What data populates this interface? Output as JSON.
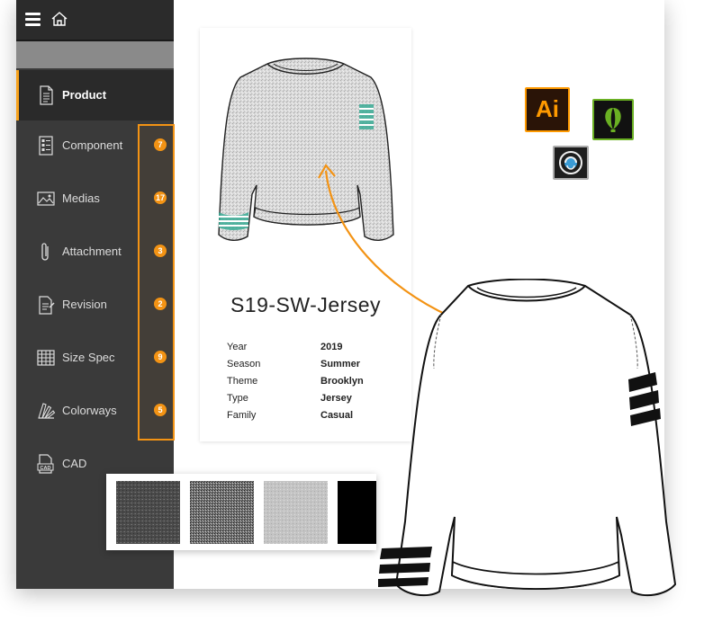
{
  "sidebar": {
    "items": [
      {
        "label": "Product",
        "icon": "document-icon"
      },
      {
        "label": "Component",
        "icon": "component-list-icon",
        "badge": "7"
      },
      {
        "label": "Medias",
        "icon": "image-icon",
        "badge": "17"
      },
      {
        "label": "Attachment",
        "icon": "paperclip-icon",
        "badge": "3"
      },
      {
        "label": "Revision",
        "icon": "revision-document-icon",
        "badge": "2"
      },
      {
        "label": "Size Spec",
        "icon": "grid-table-icon",
        "badge": "9"
      },
      {
        "label": "Colorways",
        "icon": "color-swatch-icon",
        "badge": "5"
      },
      {
        "label": "CAD",
        "icon": "cad-file-icon"
      }
    ]
  },
  "product": {
    "title": "S19-SW-Jersey",
    "attributes": [
      {
        "key": "Year",
        "value": "2019"
      },
      {
        "key": "Season",
        "value": "Summer"
      },
      {
        "key": "Theme",
        "value": "Brooklyn"
      },
      {
        "key": "Type",
        "value": "Jersey"
      },
      {
        "key": "Family",
        "value": "Casual"
      }
    ]
  },
  "apps": {
    "illustrator_label": "Ai"
  },
  "colors": {
    "accent": "#f39314",
    "sidebar_bg": "#3a3a3a",
    "stripe_teal": "#3aaa94"
  }
}
